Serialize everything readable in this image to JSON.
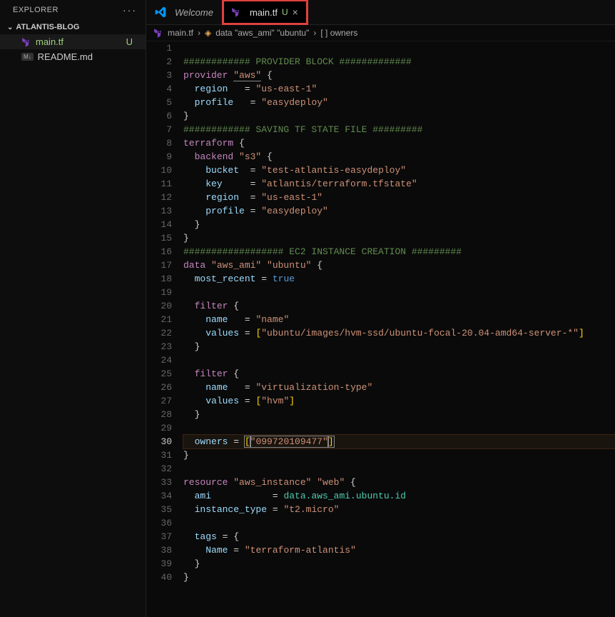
{
  "sidebar": {
    "title": "EXPLORER",
    "project": "ATLANTIS-BLOG",
    "files": [
      {
        "name": "main.tf",
        "badge": "U",
        "icon": "tf",
        "active": true
      },
      {
        "name": "README.md",
        "badge": "",
        "icon": "md",
        "active": false
      }
    ]
  },
  "tabs": [
    {
      "label": "Welcome",
      "icon": "vscode",
      "active": false,
      "highlighted": false
    },
    {
      "label": "main.tf",
      "icon": "tf",
      "badge": "U",
      "active": true,
      "closeable": true,
      "highlighted": true
    }
  ],
  "breadcrumb": {
    "file": "main.tf",
    "symbol": "data \"aws_ami\" \"ubuntu\"",
    "sub": "[ ] owners"
  },
  "code": {
    "cursor_line": 30,
    "lines": [
      {
        "n": 1,
        "t": []
      },
      {
        "n": 2,
        "t": [
          [
            "c-comment",
            "############ PROVIDER BLOCK #############"
          ]
        ]
      },
      {
        "n": 3,
        "t": [
          [
            "c-keyword",
            "provider "
          ],
          [
            "c-string underline",
            "\"aws\""
          ],
          [
            "c-punc",
            " {"
          ]
        ]
      },
      {
        "n": 4,
        "t": [
          [
            "",
            "  "
          ],
          [
            "c-prop",
            "region"
          ],
          [
            "",
            "   = "
          ],
          [
            "c-string",
            "\"us-east-1\""
          ]
        ]
      },
      {
        "n": 5,
        "t": [
          [
            "",
            "  "
          ],
          [
            "c-prop",
            "profile"
          ],
          [
            "",
            "   = "
          ],
          [
            "c-string",
            "\"easydeploy\""
          ]
        ]
      },
      {
        "n": 6,
        "t": [
          [
            "c-punc",
            "}"
          ]
        ]
      },
      {
        "n": 7,
        "t": [
          [
            "c-comment",
            "############ SAVING TF STATE FILE #########"
          ]
        ]
      },
      {
        "n": 8,
        "t": [
          [
            "c-keyword",
            "terraform"
          ],
          [
            "c-punc",
            " {"
          ]
        ]
      },
      {
        "n": 9,
        "t": [
          [
            "",
            "  "
          ],
          [
            "c-keyword",
            "backend "
          ],
          [
            "c-string",
            "\"s3\""
          ],
          [
            "c-punc",
            " {"
          ]
        ]
      },
      {
        "n": 10,
        "t": [
          [
            "",
            "    "
          ],
          [
            "c-prop",
            "bucket"
          ],
          [
            "",
            "  = "
          ],
          [
            "c-string",
            "\"test-atlantis-easydeploy\""
          ]
        ]
      },
      {
        "n": 11,
        "t": [
          [
            "",
            "    "
          ],
          [
            "c-prop",
            "key"
          ],
          [
            "",
            "     = "
          ],
          [
            "c-string",
            "\"atlantis/terraform.tfstate\""
          ]
        ]
      },
      {
        "n": 12,
        "t": [
          [
            "",
            "    "
          ],
          [
            "c-prop",
            "region"
          ],
          [
            "",
            "  = "
          ],
          [
            "c-string",
            "\"us-east-1\""
          ]
        ]
      },
      {
        "n": 13,
        "t": [
          [
            "",
            "    "
          ],
          [
            "c-prop",
            "profile"
          ],
          [
            "",
            " = "
          ],
          [
            "c-string",
            "\"easydeploy\""
          ]
        ]
      },
      {
        "n": 14,
        "t": [
          [
            "",
            "  "
          ],
          [
            "c-punc",
            "}"
          ]
        ]
      },
      {
        "n": 15,
        "t": [
          [
            "c-punc",
            "}"
          ]
        ]
      },
      {
        "n": 16,
        "t": [
          [
            "c-comment",
            "################## EC2 INSTANCE CREATION #########"
          ]
        ]
      },
      {
        "n": 17,
        "t": [
          [
            "c-keyword",
            "data "
          ],
          [
            "c-string",
            "\"aws_ami\" \"ubuntu\""
          ],
          [
            "c-punc",
            " {"
          ]
        ]
      },
      {
        "n": 18,
        "t": [
          [
            "",
            "  "
          ],
          [
            "c-prop",
            "most_recent"
          ],
          [
            "",
            " = "
          ],
          [
            "c-blue",
            "true"
          ]
        ]
      },
      {
        "n": 19,
        "t": []
      },
      {
        "n": 20,
        "t": [
          [
            "",
            "  "
          ],
          [
            "c-keyword",
            "filter"
          ],
          [
            "c-punc",
            " {"
          ]
        ]
      },
      {
        "n": 21,
        "t": [
          [
            "",
            "    "
          ],
          [
            "c-prop",
            "name"
          ],
          [
            "",
            "   = "
          ],
          [
            "c-string",
            "\"name\""
          ]
        ]
      },
      {
        "n": 22,
        "t": [
          [
            "",
            "    "
          ],
          [
            "c-prop",
            "values"
          ],
          [
            "",
            " = "
          ],
          [
            "c-delim",
            "["
          ],
          [
            "c-string",
            "\"ubuntu/images/hvm-ssd/ubuntu-focal-20.04-amd64-server-*\""
          ],
          [
            "c-delim",
            "]"
          ]
        ]
      },
      {
        "n": 23,
        "t": [
          [
            "",
            "  "
          ],
          [
            "c-punc",
            "}"
          ]
        ]
      },
      {
        "n": 24,
        "t": []
      },
      {
        "n": 25,
        "t": [
          [
            "",
            "  "
          ],
          [
            "c-keyword",
            "filter"
          ],
          [
            "c-punc",
            " {"
          ]
        ]
      },
      {
        "n": 26,
        "t": [
          [
            "",
            "    "
          ],
          [
            "c-prop",
            "name"
          ],
          [
            "",
            "   = "
          ],
          [
            "c-string",
            "\"virtualization-type\""
          ]
        ]
      },
      {
        "n": 27,
        "t": [
          [
            "",
            "    "
          ],
          [
            "c-prop",
            "values"
          ],
          [
            "",
            " = "
          ],
          [
            "c-delim",
            "["
          ],
          [
            "c-string",
            "\"hvm\""
          ],
          [
            "c-delim",
            "]"
          ]
        ]
      },
      {
        "n": 28,
        "t": [
          [
            "",
            "  "
          ],
          [
            "c-punc",
            "}"
          ]
        ]
      },
      {
        "n": 29,
        "t": []
      },
      {
        "n": 30,
        "t": [
          [
            "",
            "  "
          ],
          [
            "c-prop",
            "owners"
          ],
          [
            "",
            " = "
          ],
          [
            "c-delim sel",
            "["
          ],
          [
            "c-string sel",
            "\"099720109477\""
          ],
          [
            "c-delim sel",
            "]"
          ]
        ]
      },
      {
        "n": 31,
        "t": [
          [
            "c-punc",
            "}"
          ]
        ]
      },
      {
        "n": 32,
        "t": []
      },
      {
        "n": 33,
        "t": [
          [
            "c-keyword",
            "resource "
          ],
          [
            "c-string",
            "\"aws_instance\" \"web\""
          ],
          [
            "c-punc",
            " {"
          ]
        ]
      },
      {
        "n": 34,
        "t": [
          [
            "",
            "  "
          ],
          [
            "c-prop",
            "ami"
          ],
          [
            "",
            "           = "
          ],
          [
            "c-type",
            "data.aws_ami.ubuntu.id"
          ]
        ]
      },
      {
        "n": 35,
        "t": [
          [
            "",
            "  "
          ],
          [
            "c-prop",
            "instance_type"
          ],
          [
            "",
            " = "
          ],
          [
            "c-string",
            "\"t2.micro\""
          ]
        ]
      },
      {
        "n": 36,
        "t": []
      },
      {
        "n": 37,
        "t": [
          [
            "",
            "  "
          ],
          [
            "c-prop",
            "tags"
          ],
          [
            "",
            " = {"
          ]
        ]
      },
      {
        "n": 38,
        "t": [
          [
            "",
            "    "
          ],
          [
            "c-prop",
            "Name"
          ],
          [
            "",
            " = "
          ],
          [
            "c-string",
            "\"terraform-atlantis\""
          ]
        ]
      },
      {
        "n": 39,
        "t": [
          [
            "",
            "  "
          ],
          [
            "c-punc",
            "}"
          ]
        ]
      },
      {
        "n": 40,
        "t": [
          [
            "c-punc",
            "}"
          ]
        ]
      }
    ]
  }
}
